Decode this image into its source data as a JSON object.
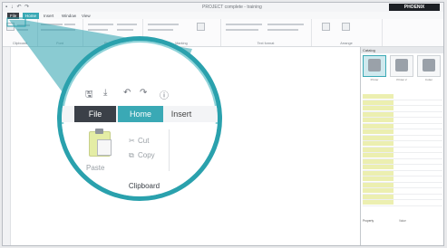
{
  "window": {
    "title": "PROJECT complete - training",
    "brand": "PHOENIX"
  },
  "tabs_small": [
    {
      "label": "File"
    },
    {
      "label": "Home"
    },
    {
      "label": "Insert"
    },
    {
      "label": "Window"
    },
    {
      "label": "View"
    }
  ],
  "ribbon_groups": [
    {
      "label": "Clipboard"
    },
    {
      "label": "Font"
    },
    {
      "label": "Paragraph"
    },
    {
      "label": "Marking"
    },
    {
      "label": "Text format"
    },
    {
      "label": "Arrange"
    }
  ],
  "magnifier": {
    "tabs": {
      "file": "File",
      "home": "Home",
      "insert": "Insert"
    },
    "paste_label": "Paste",
    "cut_label": "Cut",
    "copy_label": "Copy",
    "group_label": "Clipboard"
  },
  "panel": {
    "header": "Catalog",
    "thumbs": [
      {
        "caption": "Printer"
      },
      {
        "caption": "Printer 2"
      },
      {
        "caption": "Cutter"
      }
    ],
    "rows": [
      {
        "key": "",
        "value": ""
      },
      {
        "key": "",
        "value": ""
      },
      {
        "key": "",
        "value": ""
      },
      {
        "key": "",
        "value": ""
      },
      {
        "key": "",
        "value": ""
      },
      {
        "key": "",
        "value": ""
      },
      {
        "key": "",
        "value": ""
      },
      {
        "key": "",
        "value": ""
      },
      {
        "key": "",
        "value": ""
      },
      {
        "key": "",
        "value": ""
      },
      {
        "key": "",
        "value": ""
      },
      {
        "key": "",
        "value": ""
      },
      {
        "key": "",
        "value": ""
      },
      {
        "key": "",
        "value": ""
      },
      {
        "key": "",
        "value": ""
      },
      {
        "key": "",
        "value": ""
      },
      {
        "key": "",
        "value": ""
      },
      {
        "key": "",
        "value": ""
      },
      {
        "key": "",
        "value": ""
      }
    ],
    "properties": [
      {
        "key": "Property",
        "value": "Value"
      },
      {
        "key": "",
        "value": ""
      },
      {
        "key": "",
        "value": ""
      },
      {
        "key": "",
        "value": ""
      }
    ]
  },
  "colors": {
    "accent": "#3aa9b5",
    "file_tab": "#3b4048",
    "highlight": "#ecefb0"
  }
}
